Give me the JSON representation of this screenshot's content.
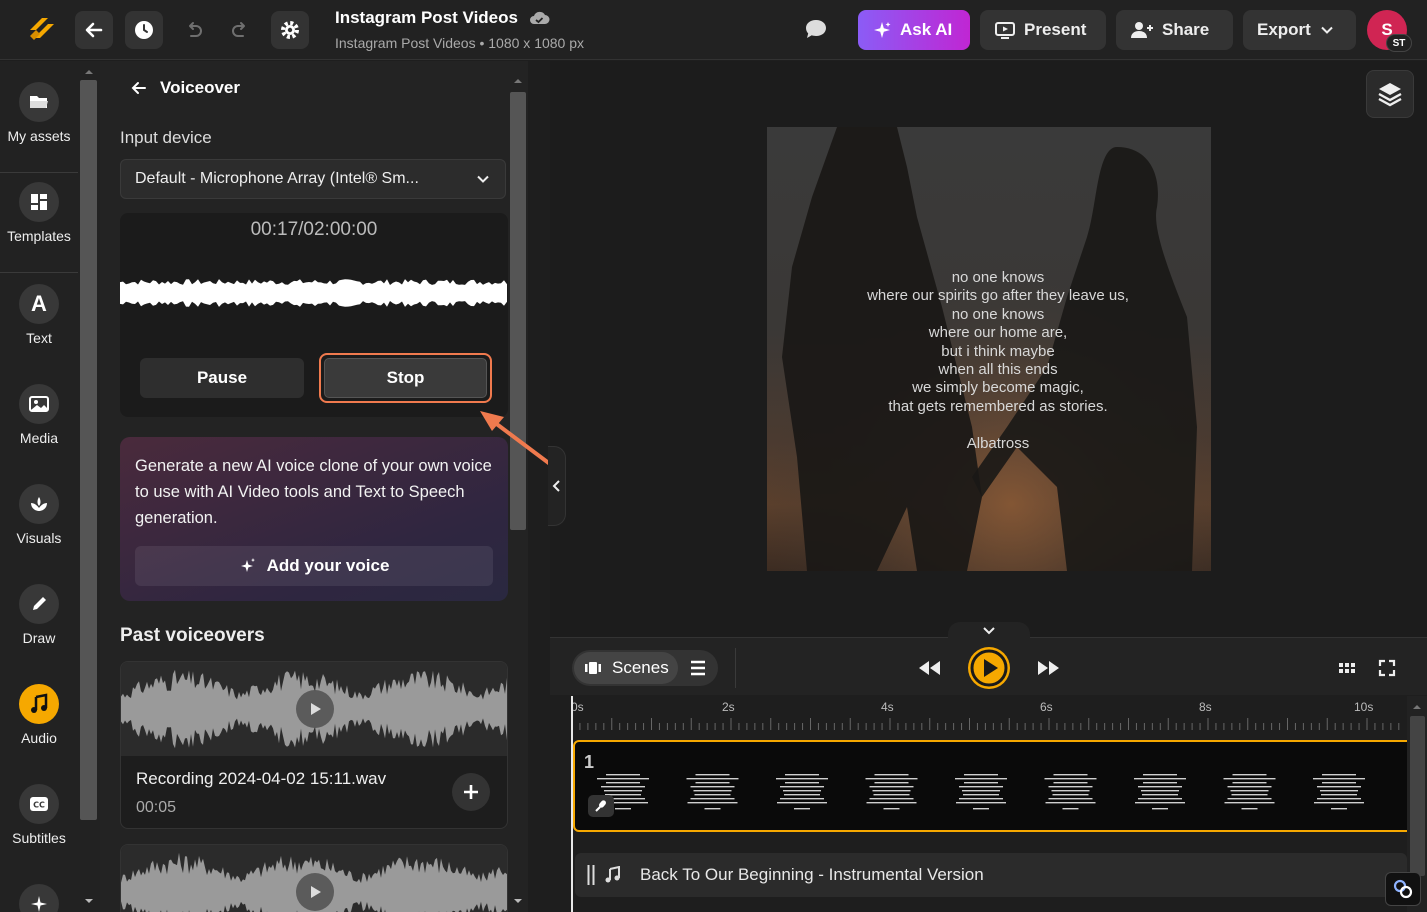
{
  "topbar": {
    "title": "Instagram Post Videos",
    "subtitle": "Instagram Post Videos • 1080 x 1080 px",
    "ask_ai": "Ask AI",
    "present": "Present",
    "share": "Share",
    "export": "Export",
    "avatar_initial": "S",
    "avatar_badge": "ST"
  },
  "rail": [
    {
      "label": "My assets",
      "icon": "folder-icon"
    },
    {
      "label": "Templates",
      "icon": "templates-icon"
    },
    {
      "label": "Text",
      "icon": "text-icon"
    },
    {
      "label": "Media",
      "icon": "image-icon"
    },
    {
      "label": "Visuals",
      "icon": "visuals-icon"
    },
    {
      "label": "Draw",
      "icon": "pen-icon"
    },
    {
      "label": "Audio",
      "icon": "music-note-icon"
    },
    {
      "label": "Subtitles",
      "icon": "subtitles-icon"
    }
  ],
  "voiceover": {
    "title": "Voiceover",
    "input_label": "Input device",
    "device": "Default - Microphone Array (Intel® Sm...",
    "timer": "00:17/02:00:00",
    "pause": "Pause",
    "stop": "Stop",
    "promo_text": "Generate a new AI voice clone of your own voice to use with AI Video tools and Text to Speech generation.",
    "promo_button": "Add your voice",
    "past_heading": "Past voiceovers",
    "recordings": [
      {
        "name": "Recording 2024-04-02 15:11.wav",
        "duration": "00:05"
      }
    ]
  },
  "canvas": {
    "poem": [
      "no one knows",
      "where our spirits go after they leave us,",
      "no one knows",
      "where our home are,",
      "but i think maybe",
      "when all this ends",
      "we simply become magic,",
      "that gets remembered as stories."
    ],
    "author": "Albatross"
  },
  "playback": {
    "scenes_label": "Scenes"
  },
  "timeline": {
    "ruler": [
      "0s",
      "2s",
      "4s",
      "6s",
      "8s",
      "10s"
    ],
    "scene_number": "1",
    "audio_track": "Back To Our Beginning - Instrumental Version"
  },
  "colors": {
    "accent": "#f6a800",
    "ai_gradient_start": "#8b5cf6",
    "ai_gradient_end": "#c026d3",
    "highlight": "#f07a4e",
    "avatar": "#d02553"
  }
}
